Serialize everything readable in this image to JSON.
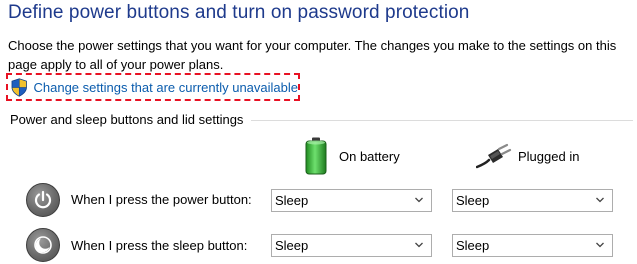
{
  "page": {
    "title": "Define power buttons and turn on password protection",
    "description": "Choose the power settings that you want for your computer. The changes you make to the settings on this page apply to all of your power plans.",
    "change_link": "Change settings that are currently unavailable"
  },
  "section": {
    "title": "Power and sleep buttons and lid settings"
  },
  "columns": {
    "battery": "On battery",
    "plugged": "Plugged in"
  },
  "rows": [
    {
      "label": "When I press the power button:",
      "battery": "Sleep",
      "plugged": "Sleep",
      "icon": "power-button-icon"
    },
    {
      "label": "When I press the sleep button:",
      "battery": "Sleep",
      "plugged": "Sleep",
      "icon": "sleep-button-icon"
    }
  ],
  "colors": {
    "title": "#1e3a8c",
    "link": "#0b5cad",
    "highlight_border": "#e81123",
    "battery_green": "#3cb43c"
  }
}
